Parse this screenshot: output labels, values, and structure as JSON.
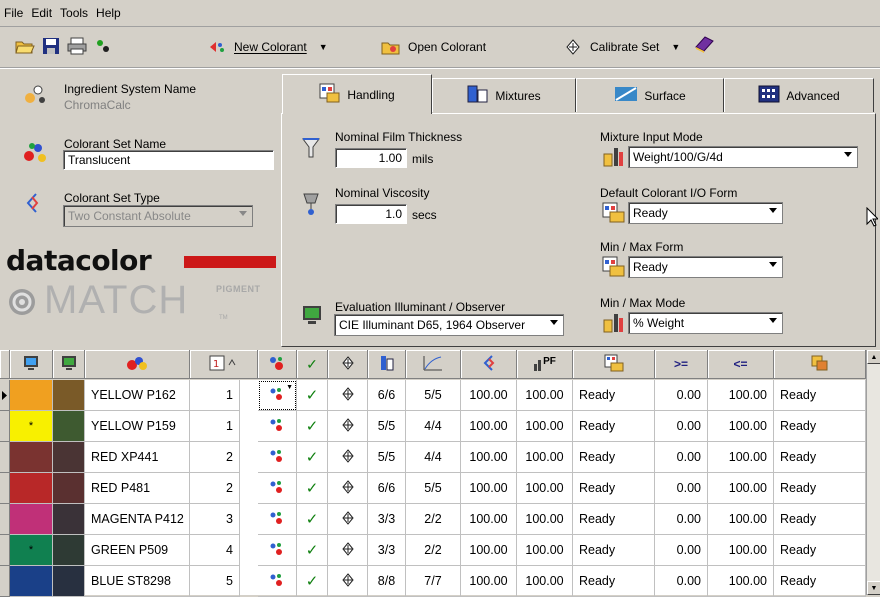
{
  "menu": [
    "File",
    "Edit",
    "Tools",
    "Help"
  ],
  "toolbar": {
    "new_colorant": "New Colorant",
    "open_colorant": "Open Colorant",
    "calibrate_set": "Calibrate Set"
  },
  "left": {
    "ingredient_label": "Ingredient System Name",
    "ingredient_value": "ChromaCalc",
    "set_name_label": "Colorant Set Name",
    "set_name_value": "Translucent",
    "set_type_label": "Colorant Set Type",
    "set_type_value": "Two Constant Absolute",
    "logo_word": "datacolor",
    "logo_match": "MATCH",
    "logo_pigment": "PIGMENT",
    "logo_tm": "TM"
  },
  "tabs": [
    "Handling",
    "Mixtures",
    "Surface",
    "Advanced"
  ],
  "handling": {
    "film_label": "Nominal Film Thickness",
    "film_value": "1.00",
    "film_unit": "mils",
    "visc_label": "Nominal Viscosity",
    "visc_value": "1.0",
    "visc_unit": "secs",
    "illum_label": "Evaluation Illuminant / Observer",
    "illum_value": "CIE Illuminant D65, 1964 Observer",
    "mix_mode_label": "Mixture Input Mode",
    "mix_mode_value": "Weight/100/G/4d",
    "io_label": "Default Colorant I/O Form",
    "io_value": "Ready",
    "minmax_form_label": "Min / Max Form",
    "minmax_form_value": "Ready",
    "minmax_mode_label": "Min / Max Mode",
    "minmax_mode_value": "% Weight"
  },
  "grid": {
    "header_text": {
      "pf": "PF",
      "ge": ">=",
      "le": "<="
    },
    "rows": [
      {
        "swatch1": "#f0a020",
        "swatch2": "#7a5a28",
        "star": "",
        "name": "YELLOW P162",
        "num": "1",
        "f1": "6/6",
        "f2": "5/5",
        "v1": "100.00",
        "v2": "100.00",
        "form": "Ready",
        "min": "0.00",
        "max": "100.00",
        "form2": "Ready"
      },
      {
        "swatch1": "#f8f000",
        "swatch2": "#3e5a30",
        "star": "*",
        "name": "YELLOW P159",
        "num": "1",
        "f1": "5/5",
        "f2": "4/4",
        "v1": "100.00",
        "v2": "100.00",
        "form": "Ready",
        "min": "0.00",
        "max": "100.00",
        "form2": "Ready"
      },
      {
        "swatch1": "#7a3330",
        "swatch2": "#4a3434",
        "star": "",
        "name": "RED XP441",
        "num": "2",
        "f1": "5/5",
        "f2": "4/4",
        "v1": "100.00",
        "v2": "100.00",
        "form": "Ready",
        "min": "0.00",
        "max": "100.00",
        "form2": "Ready"
      },
      {
        "swatch1": "#b82828",
        "swatch2": "#5a3030",
        "star": "",
        "name": "RED P481",
        "num": "2",
        "f1": "6/6",
        "f2": "5/5",
        "v1": "100.00",
        "v2": "100.00",
        "form": "Ready",
        "min": "0.00",
        "max": "100.00",
        "form2": "Ready"
      },
      {
        "swatch1": "#c03078",
        "swatch2": "#3a3238",
        "star": "",
        "name": "MAGENTA P412",
        "num": "3",
        "f1": "3/3",
        "f2": "2/2",
        "v1": "100.00",
        "v2": "100.00",
        "form": "Ready",
        "min": "0.00",
        "max": "100.00",
        "form2": "Ready"
      },
      {
        "swatch1": "#108050",
        "swatch2": "#2e3a34",
        "star": "*",
        "name": "GREEN P509",
        "num": "4",
        "f1": "3/3",
        "f2": "2/2",
        "v1": "100.00",
        "v2": "100.00",
        "form": "Ready",
        "min": "0.00",
        "max": "100.00",
        "form2": "Ready"
      },
      {
        "swatch1": "#1a4088",
        "swatch2": "#283040",
        "star": "",
        "name": "BLUE ST8298",
        "num": "5",
        "f1": "8/8",
        "f2": "7/7",
        "v1": "100.00",
        "v2": "100.00",
        "form": "Ready",
        "min": "0.00",
        "max": "100.00",
        "form2": "Ready"
      }
    ]
  }
}
